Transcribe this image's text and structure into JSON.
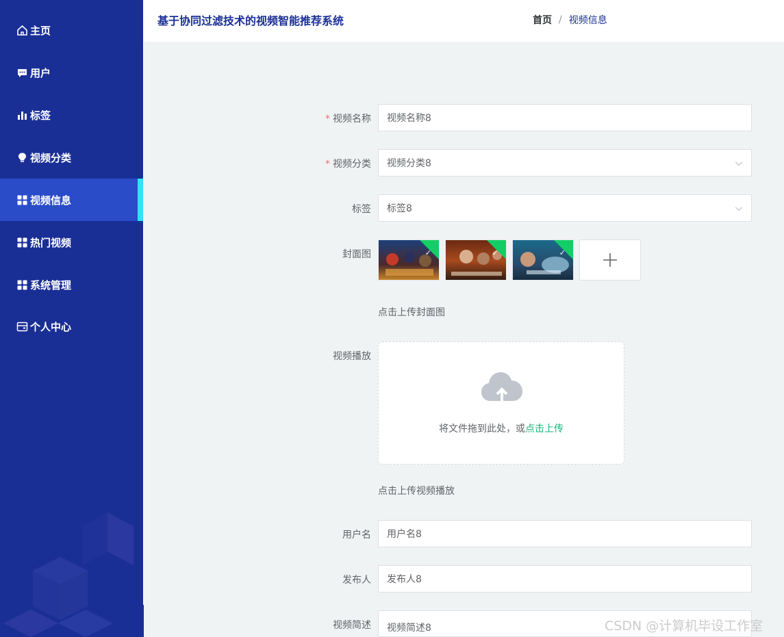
{
  "app": {
    "title": "基于协同过滤技术的视频智能推荐系统"
  },
  "breadcrumb": {
    "home": "首页",
    "separator": "/",
    "current": "视频信息"
  },
  "sidebar": {
    "items": [
      {
        "label": "主页",
        "icon": "home-icon"
      },
      {
        "label": "用户",
        "icon": "chat-icon"
      },
      {
        "label": "标签",
        "icon": "bar-chart-icon"
      },
      {
        "label": "视频分类",
        "icon": "lightbulb-icon"
      },
      {
        "label": "视频信息",
        "icon": "grid-icon",
        "active": true
      },
      {
        "label": "热门视频",
        "icon": "grid-icon"
      },
      {
        "label": "系统管理",
        "icon": "grid-icon"
      },
      {
        "label": "个人中心",
        "icon": "wallet-icon"
      }
    ]
  },
  "form": {
    "video_name": {
      "label": "视频名称",
      "required": true,
      "value": "视频名称8"
    },
    "video_category": {
      "label": "视频分类",
      "required": true,
      "value": "视频分类8"
    },
    "tag": {
      "label": "标签",
      "value": "标签8"
    },
    "cover": {
      "label": "封面图",
      "tip": "点击上传封面图",
      "image_count": 3
    },
    "video_play": {
      "label": "视频播放",
      "drop_text": "将文件拖到此处，或",
      "drop_link": "点击上传",
      "tip": "点击上传视频播放"
    },
    "username": {
      "label": "用户名",
      "value": "用户名8"
    },
    "publisher": {
      "label": "发布人",
      "value": "发布人8"
    },
    "description": {
      "label": "视频简述",
      "value": "视频简述8"
    }
  },
  "watermark": "CSDN @计算机毕设工作室",
  "colors": {
    "sidebar": "#1a2f96",
    "active": "#2a4cc9",
    "accent": "#33e1f8",
    "link": "#17b37a",
    "required": "#f56c6c"
  }
}
